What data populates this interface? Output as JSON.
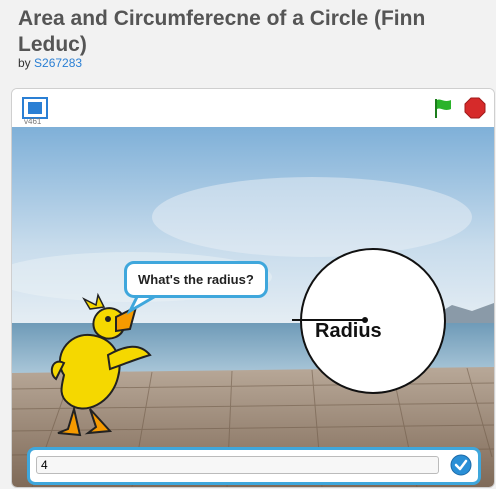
{
  "project": {
    "title": "Area and Circumferecne of a Circle (Finn Leduc)",
    "by_label": "by",
    "author": "S267283"
  },
  "player": {
    "version": "v461",
    "fullscreen_icon": "fullscreen-icon",
    "flag_icon": "green-flag-icon",
    "stop_icon": "stop-sign-icon"
  },
  "stage": {
    "speech_bubble": "What's the radius?",
    "circle_label": "Radius",
    "answer_value": "4"
  },
  "colors": {
    "accent": "#3fa7dc",
    "flag": "#2ab32a",
    "stop": "#d62a2a",
    "duck": "#f5d800"
  }
}
